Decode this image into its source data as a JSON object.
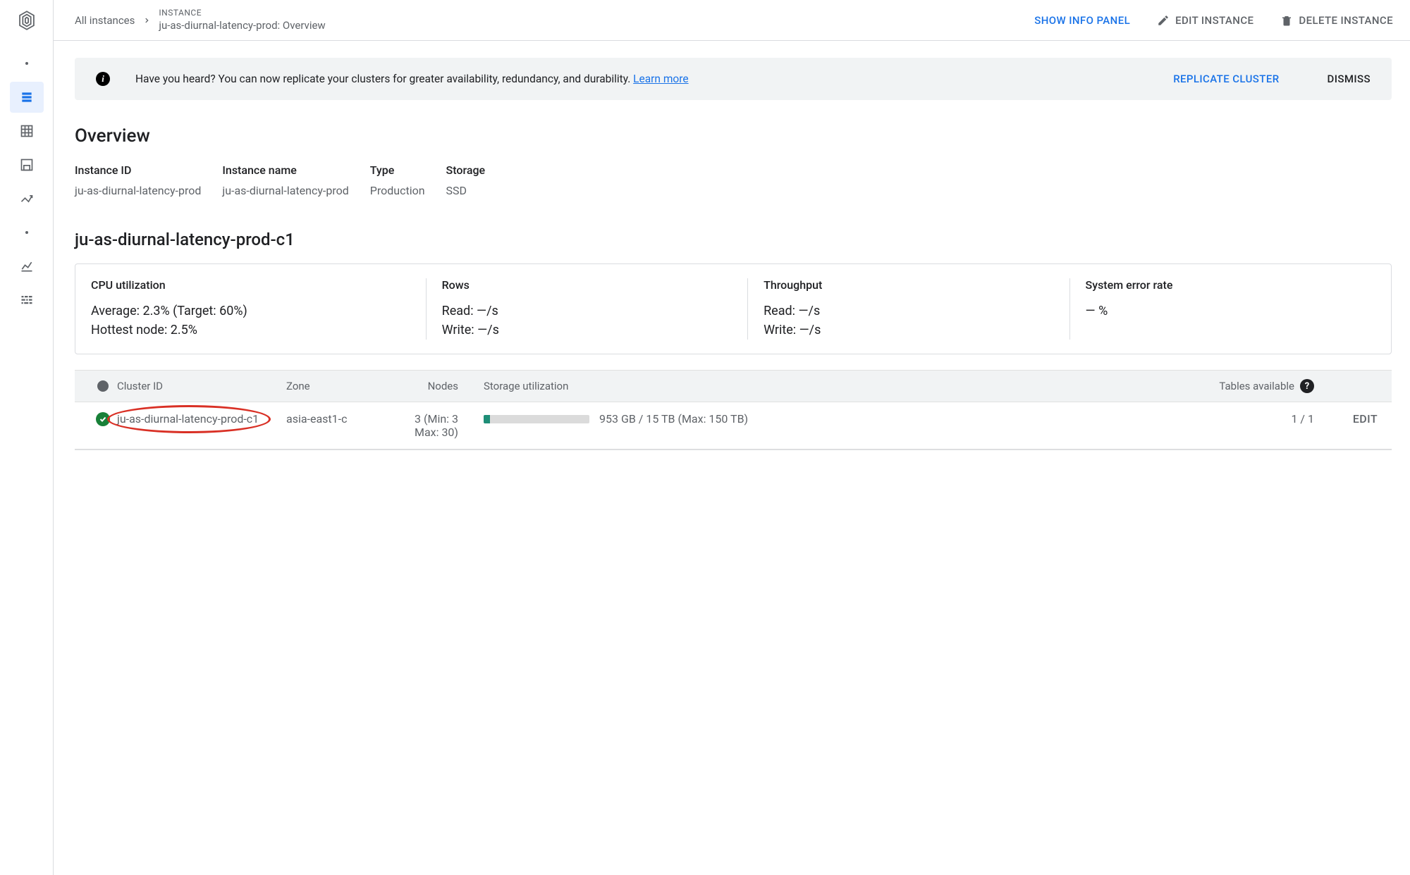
{
  "breadcrumb": {
    "root": "All instances",
    "label_top": "INSTANCE",
    "label_bottom": "ju-as-diurnal-latency-prod: Overview"
  },
  "top_actions": {
    "info_panel": "SHOW INFO PANEL",
    "edit": "EDIT INSTANCE",
    "delete": "DELETE INSTANCE"
  },
  "banner": {
    "text": "Have you heard? You can now replicate your clusters for greater availability, redundancy, and durability. ",
    "learn_more": "Learn more",
    "replicate": "REPLICATE CLUSTER",
    "dismiss": "DISMISS"
  },
  "overview": {
    "title": "Overview",
    "fields": {
      "instance_id": {
        "label": "Instance ID",
        "value": "ju-as-diurnal-latency-prod"
      },
      "instance_name": {
        "label": "Instance name",
        "value": "ju-as-diurnal-latency-prod"
      },
      "type": {
        "label": "Type",
        "value": "Production"
      },
      "storage": {
        "label": "Storage",
        "value": "SSD"
      }
    }
  },
  "cluster": {
    "title": "ju-as-diurnal-latency-prod-c1",
    "stats": {
      "cpu": {
        "label": "CPU utilization",
        "line1": "Average: 2.3% (Target: 60%)",
        "line2": "Hottest node: 2.5%"
      },
      "rows": {
        "label": "Rows",
        "line1": "Read: —/s",
        "line2": "Write: —/s"
      },
      "throughput": {
        "label": "Throughput",
        "line1": "Read: —/s",
        "line2": "Write: —/s"
      },
      "error": {
        "label": "System error rate",
        "line1": "— %"
      }
    }
  },
  "table": {
    "headers": {
      "cluster_id": "Cluster ID",
      "zone": "Zone",
      "nodes": "Nodes",
      "storage": "Storage utilization",
      "tables": "Tables available"
    },
    "row": {
      "cluster_id": "ju-as-diurnal-latency-prod-c1",
      "zone": "asia-east1-c",
      "nodes": "3 (Min: 3 Max: 30)",
      "storage_text": "953 GB / 15 TB (Max: 150 TB)",
      "storage_pct": 6,
      "tables": "1 / 1",
      "edit": "EDIT"
    }
  }
}
